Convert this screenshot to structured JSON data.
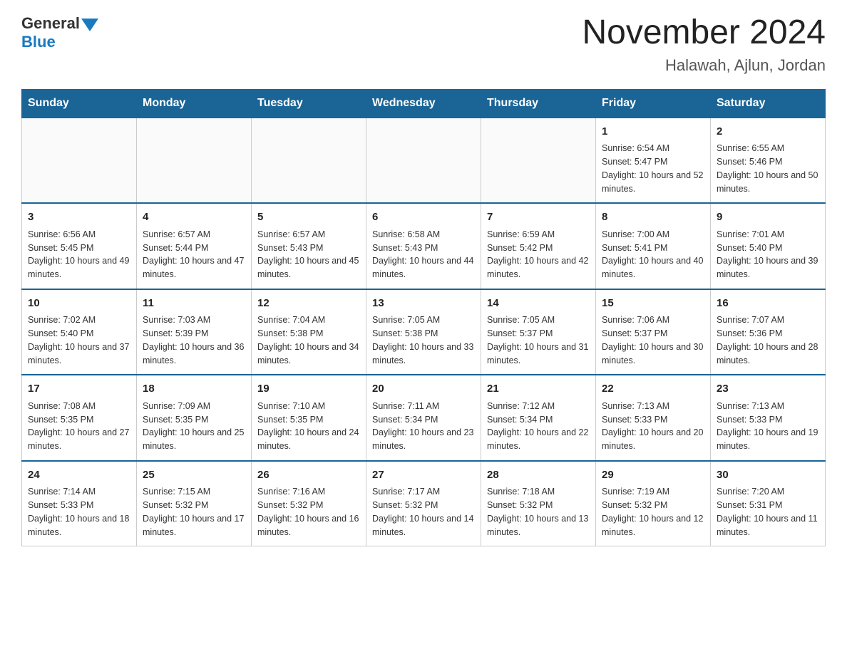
{
  "header": {
    "logo_general": "General",
    "logo_blue": "Blue",
    "month_year": "November 2024",
    "location": "Halawah, Ajlun, Jordan"
  },
  "calendar": {
    "days_of_week": [
      "Sunday",
      "Monday",
      "Tuesday",
      "Wednesday",
      "Thursday",
      "Friday",
      "Saturday"
    ],
    "weeks": [
      [
        {
          "day": "",
          "info": ""
        },
        {
          "day": "",
          "info": ""
        },
        {
          "day": "",
          "info": ""
        },
        {
          "day": "",
          "info": ""
        },
        {
          "day": "",
          "info": ""
        },
        {
          "day": "1",
          "info": "Sunrise: 6:54 AM\nSunset: 5:47 PM\nDaylight: 10 hours and 52 minutes."
        },
        {
          "day": "2",
          "info": "Sunrise: 6:55 AM\nSunset: 5:46 PM\nDaylight: 10 hours and 50 minutes."
        }
      ],
      [
        {
          "day": "3",
          "info": "Sunrise: 6:56 AM\nSunset: 5:45 PM\nDaylight: 10 hours and 49 minutes."
        },
        {
          "day": "4",
          "info": "Sunrise: 6:57 AM\nSunset: 5:44 PM\nDaylight: 10 hours and 47 minutes."
        },
        {
          "day": "5",
          "info": "Sunrise: 6:57 AM\nSunset: 5:43 PM\nDaylight: 10 hours and 45 minutes."
        },
        {
          "day": "6",
          "info": "Sunrise: 6:58 AM\nSunset: 5:43 PM\nDaylight: 10 hours and 44 minutes."
        },
        {
          "day": "7",
          "info": "Sunrise: 6:59 AM\nSunset: 5:42 PM\nDaylight: 10 hours and 42 minutes."
        },
        {
          "day": "8",
          "info": "Sunrise: 7:00 AM\nSunset: 5:41 PM\nDaylight: 10 hours and 40 minutes."
        },
        {
          "day": "9",
          "info": "Sunrise: 7:01 AM\nSunset: 5:40 PM\nDaylight: 10 hours and 39 minutes."
        }
      ],
      [
        {
          "day": "10",
          "info": "Sunrise: 7:02 AM\nSunset: 5:40 PM\nDaylight: 10 hours and 37 minutes."
        },
        {
          "day": "11",
          "info": "Sunrise: 7:03 AM\nSunset: 5:39 PM\nDaylight: 10 hours and 36 minutes."
        },
        {
          "day": "12",
          "info": "Sunrise: 7:04 AM\nSunset: 5:38 PM\nDaylight: 10 hours and 34 minutes."
        },
        {
          "day": "13",
          "info": "Sunrise: 7:05 AM\nSunset: 5:38 PM\nDaylight: 10 hours and 33 minutes."
        },
        {
          "day": "14",
          "info": "Sunrise: 7:05 AM\nSunset: 5:37 PM\nDaylight: 10 hours and 31 minutes."
        },
        {
          "day": "15",
          "info": "Sunrise: 7:06 AM\nSunset: 5:37 PM\nDaylight: 10 hours and 30 minutes."
        },
        {
          "day": "16",
          "info": "Sunrise: 7:07 AM\nSunset: 5:36 PM\nDaylight: 10 hours and 28 minutes."
        }
      ],
      [
        {
          "day": "17",
          "info": "Sunrise: 7:08 AM\nSunset: 5:35 PM\nDaylight: 10 hours and 27 minutes."
        },
        {
          "day": "18",
          "info": "Sunrise: 7:09 AM\nSunset: 5:35 PM\nDaylight: 10 hours and 25 minutes."
        },
        {
          "day": "19",
          "info": "Sunrise: 7:10 AM\nSunset: 5:35 PM\nDaylight: 10 hours and 24 minutes."
        },
        {
          "day": "20",
          "info": "Sunrise: 7:11 AM\nSunset: 5:34 PM\nDaylight: 10 hours and 23 minutes."
        },
        {
          "day": "21",
          "info": "Sunrise: 7:12 AM\nSunset: 5:34 PM\nDaylight: 10 hours and 22 minutes."
        },
        {
          "day": "22",
          "info": "Sunrise: 7:13 AM\nSunset: 5:33 PM\nDaylight: 10 hours and 20 minutes."
        },
        {
          "day": "23",
          "info": "Sunrise: 7:13 AM\nSunset: 5:33 PM\nDaylight: 10 hours and 19 minutes."
        }
      ],
      [
        {
          "day": "24",
          "info": "Sunrise: 7:14 AM\nSunset: 5:33 PM\nDaylight: 10 hours and 18 minutes."
        },
        {
          "day": "25",
          "info": "Sunrise: 7:15 AM\nSunset: 5:32 PM\nDaylight: 10 hours and 17 minutes."
        },
        {
          "day": "26",
          "info": "Sunrise: 7:16 AM\nSunset: 5:32 PM\nDaylight: 10 hours and 16 minutes."
        },
        {
          "day": "27",
          "info": "Sunrise: 7:17 AM\nSunset: 5:32 PM\nDaylight: 10 hours and 14 minutes."
        },
        {
          "day": "28",
          "info": "Sunrise: 7:18 AM\nSunset: 5:32 PM\nDaylight: 10 hours and 13 minutes."
        },
        {
          "day": "29",
          "info": "Sunrise: 7:19 AM\nSunset: 5:32 PM\nDaylight: 10 hours and 12 minutes."
        },
        {
          "day": "30",
          "info": "Sunrise: 7:20 AM\nSunset: 5:31 PM\nDaylight: 10 hours and 11 minutes."
        }
      ]
    ]
  }
}
